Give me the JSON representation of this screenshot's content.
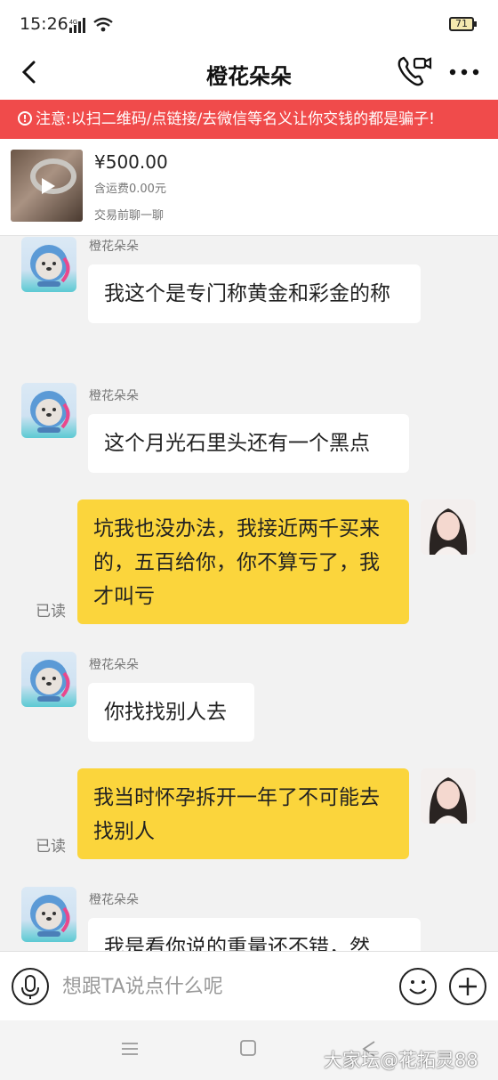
{
  "status": {
    "time": "15:26",
    "battery": "71"
  },
  "header": {
    "title": "橙花朵朵"
  },
  "warning": {
    "text": "注意:以扫二维码/点链接/去微信等名义让你交钱的都是骗子!"
  },
  "product": {
    "price": "¥500.00",
    "shipping": "含运费0.00元",
    "note": "交易前聊一聊"
  },
  "messages": [
    {
      "side": "left",
      "sender": "橙花朵朵",
      "text": "我这个是专门称黄金和彩金的称"
    },
    {
      "side": "left",
      "sender": "橙花朵朵",
      "text": "这个月光石里头还有一个黑点"
    },
    {
      "side": "right",
      "read": "已读",
      "text": "坑我也没办法，我接近两千买来的，五百给你，你不算亏了，我才叫亏"
    },
    {
      "side": "left",
      "sender": "橙花朵朵",
      "text": "你找找别人去"
    },
    {
      "side": "right",
      "read": "已读",
      "text": "我当时怀孕拆开一年了不可能去找别人"
    },
    {
      "side": "left",
      "sender": "橙花朵朵",
      "text": "我是看你说的重量还不错，然"
    }
  ],
  "input": {
    "placeholder": "想跟TA说点什么呢",
    "value": ""
  },
  "watermark": "大家坛@花拓灵88",
  "colors": {
    "warning": "#f04b4b",
    "my_bubble": "#fbd53c"
  },
  "icons": [
    "back-icon",
    "video-call-icon",
    "more-icon",
    "play-icon",
    "microphone-icon",
    "emoji-icon",
    "plus-icon"
  ]
}
